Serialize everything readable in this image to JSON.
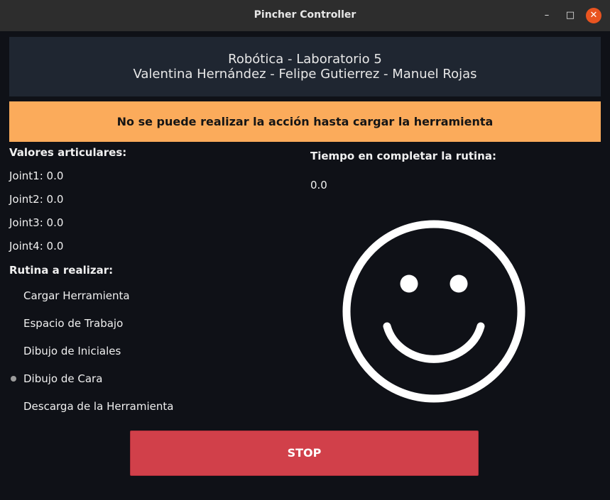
{
  "window": {
    "title": "Pincher Controller"
  },
  "header": {
    "line1": "Robótica - Laboratorio 5",
    "line2": "Valentina Hernández - Felipe Gutierrez - Manuel Rojas"
  },
  "warning": "No se puede realizar la acción hasta cargar la herramienta",
  "joints": {
    "title": "Valores articulares:",
    "items": [
      "Joint1: 0.0",
      "Joint2: 0.0",
      "Joint3: 0.0",
      "Joint4: 0.0"
    ]
  },
  "routine": {
    "title": "Rutina a realizar:",
    "options": [
      {
        "label": "Cargar Herramienta",
        "selected": false
      },
      {
        "label": "Espacio de Trabajo",
        "selected": false
      },
      {
        "label": "Dibujo de Iniciales",
        "selected": false
      },
      {
        "label": "Dibujo de Cara",
        "selected": true
      },
      {
        "label": "Descarga de la Herramienta",
        "selected": false
      }
    ]
  },
  "time": {
    "title": "Tiempo en completar la rutina:",
    "value": "0.0"
  },
  "stop_label": "STOP",
  "icons": {
    "display": "smiley-face-icon"
  },
  "colors": {
    "warning_bg": "#fbab5b",
    "stop_bg": "#d1404a",
    "header_bg": "#1f2631",
    "window_bg": "#0f1117"
  }
}
